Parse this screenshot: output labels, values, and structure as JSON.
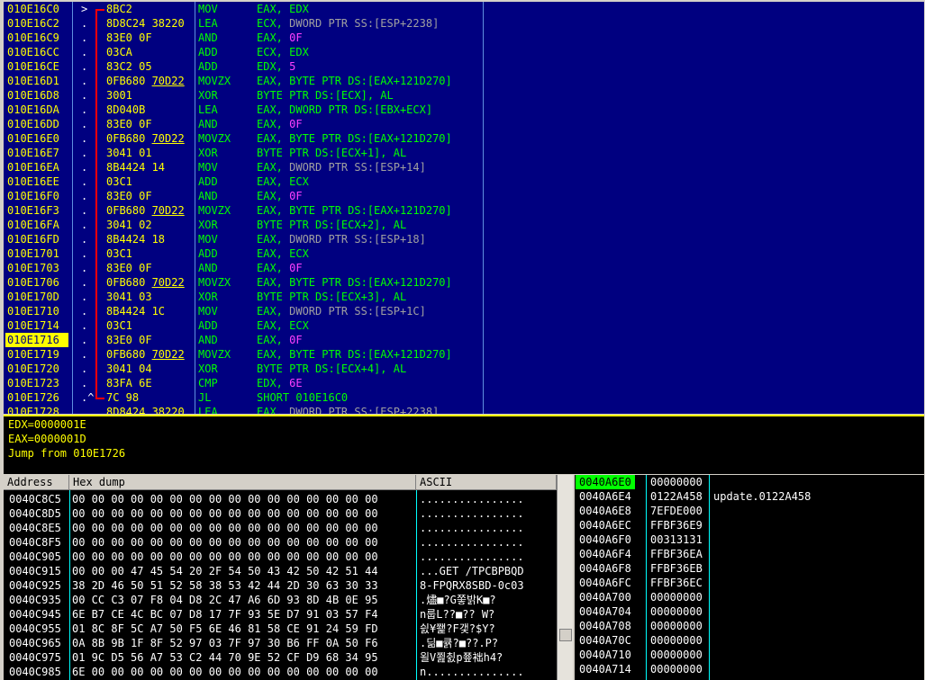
{
  "disasm": {
    "rows": [
      {
        "addr": "010E16C0",
        "mark": ">",
        "hex": "8BC2",
        "hex_ul": "",
        "mn": "MOV",
        "op": "EAX, EDX",
        "op_g": "",
        "op_m": ""
      },
      {
        "addr": "010E16C2",
        "mark": ".",
        "hex": "8D8C24 38220",
        "hex_ul": "",
        "mn": "LEA",
        "op": "ECX, ",
        "op_g": "DWORD PTR SS:[ESP+2238]",
        "op_m": ""
      },
      {
        "addr": "010E16C9",
        "mark": ".",
        "hex": "83E0 0F",
        "hex_ul": "",
        "mn": "AND",
        "op": "EAX, ",
        "op_g": "",
        "op_m": "0F"
      },
      {
        "addr": "010E16CC",
        "mark": ".",
        "hex": "03CA",
        "hex_ul": "",
        "mn": "ADD",
        "op": "ECX, EDX",
        "op_g": "",
        "op_m": ""
      },
      {
        "addr": "010E16CE",
        "mark": ".",
        "hex": "83C2 05",
        "hex_ul": "",
        "mn": "ADD",
        "op": "EDX, ",
        "op_g": "",
        "op_m": "5"
      },
      {
        "addr": "010E16D1",
        "mark": ".",
        "hex": "0FB680 ",
        "hex_ul": "70D22",
        "mn": "MOVZX",
        "op": "EAX, BYTE PTR DS:[EAX+121D270]",
        "op_g": "",
        "op_m": ""
      },
      {
        "addr": "010E16D8",
        "mark": ".",
        "hex": "3001",
        "hex_ul": "",
        "mn": "XOR",
        "op": "BYTE PTR DS:[ECX], AL",
        "op_g": "",
        "op_m": ""
      },
      {
        "addr": "010E16DA",
        "mark": ".",
        "hex": "8D040B",
        "hex_ul": "",
        "mn": "LEA",
        "op": "EAX, DWORD PTR DS:[EBX+ECX]",
        "op_g": "",
        "op_m": ""
      },
      {
        "addr": "010E16DD",
        "mark": ".",
        "hex": "83E0 0F",
        "hex_ul": "",
        "mn": "AND",
        "op": "EAX, ",
        "op_g": "",
        "op_m": "0F"
      },
      {
        "addr": "010E16E0",
        "mark": ".",
        "hex": "0FB680 ",
        "hex_ul": "70D22",
        "mn": "MOVZX",
        "op": "EAX, BYTE PTR DS:[EAX+121D270]",
        "op_g": "",
        "op_m": ""
      },
      {
        "addr": "010E16E7",
        "mark": ".",
        "hex": "3041 01",
        "hex_ul": "",
        "mn": "XOR",
        "op": "BYTE PTR DS:[ECX+1], AL",
        "op_g": "",
        "op_m": ""
      },
      {
        "addr": "010E16EA",
        "mark": ".",
        "hex": "8B4424 14",
        "hex_ul": "",
        "mn": "MOV",
        "op": "EAX, ",
        "op_g": "DWORD PTR SS:[ESP+14]",
        "op_m": ""
      },
      {
        "addr": "010E16EE",
        "mark": ".",
        "hex": "03C1",
        "hex_ul": "",
        "mn": "ADD",
        "op": "EAX, ECX",
        "op_g": "",
        "op_m": ""
      },
      {
        "addr": "010E16F0",
        "mark": ".",
        "hex": "83E0 0F",
        "hex_ul": "",
        "mn": "AND",
        "op": "EAX, ",
        "op_g": "",
        "op_m": "0F"
      },
      {
        "addr": "010E16F3",
        "mark": ".",
        "hex": "0FB680 ",
        "hex_ul": "70D22",
        "mn": "MOVZX",
        "op": "EAX, BYTE PTR DS:[EAX+121D270]",
        "op_g": "",
        "op_m": ""
      },
      {
        "addr": "010E16FA",
        "mark": ".",
        "hex": "3041 02",
        "hex_ul": "",
        "mn": "XOR",
        "op": "BYTE PTR DS:[ECX+2], AL",
        "op_g": "",
        "op_m": ""
      },
      {
        "addr": "010E16FD",
        "mark": ".",
        "hex": "8B4424 18",
        "hex_ul": "",
        "mn": "MOV",
        "op": "EAX, ",
        "op_g": "DWORD PTR SS:[ESP+18]",
        "op_m": ""
      },
      {
        "addr": "010E1701",
        "mark": ".",
        "hex": "03C1",
        "hex_ul": "",
        "mn": "ADD",
        "op": "EAX, ECX",
        "op_g": "",
        "op_m": ""
      },
      {
        "addr": "010E1703",
        "mark": ".",
        "hex": "83E0 0F",
        "hex_ul": "",
        "mn": "AND",
        "op": "EAX, ",
        "op_g": "",
        "op_m": "0F"
      },
      {
        "addr": "010E1706",
        "mark": ".",
        "hex": "0FB680 ",
        "hex_ul": "70D22",
        "mn": "MOVZX",
        "op": "EAX, BYTE PTR DS:[EAX+121D270]",
        "op_g": "",
        "op_m": ""
      },
      {
        "addr": "010E170D",
        "mark": ".",
        "hex": "3041 03",
        "hex_ul": "",
        "mn": "XOR",
        "op": "BYTE PTR DS:[ECX+3], AL",
        "op_g": "",
        "op_m": ""
      },
      {
        "addr": "010E1710",
        "mark": ".",
        "hex": "8B4424 1C",
        "hex_ul": "",
        "mn": "MOV",
        "op": "EAX, ",
        "op_g": "DWORD PTR SS:[ESP+1C]",
        "op_m": ""
      },
      {
        "addr": "010E1714",
        "mark": ".",
        "hex": "03C1",
        "hex_ul": "",
        "mn": "ADD",
        "op": "EAX, ECX",
        "op_g": "",
        "op_m": ""
      },
      {
        "addr": "010E1716",
        "mark": ".",
        "hex": "83E0 0F",
        "hex_ul": "",
        "mn": "AND",
        "op": "EAX, ",
        "op_g": "",
        "op_m": "0F",
        "selected": true
      },
      {
        "addr": "010E1719",
        "mark": ".",
        "hex": "0FB680 ",
        "hex_ul": "70D22",
        "mn": "MOVZX",
        "op": "EAX, BYTE PTR DS:[EAX+121D270]",
        "op_g": "",
        "op_m": ""
      },
      {
        "addr": "010E1720",
        "mark": ".",
        "hex": "3041 04",
        "hex_ul": "",
        "mn": "XOR",
        "op": "BYTE PTR DS:[ECX+4], AL",
        "op_g": "",
        "op_m": ""
      },
      {
        "addr": "010E1723",
        "mark": ".",
        "hex": "83FA 6E",
        "hex_ul": "",
        "mn": "CMP",
        "op": "EDX, ",
        "op_g": "",
        "op_m": "6E"
      },
      {
        "addr": "010E1726",
        "mark": ".^",
        "hex": "7C 98",
        "hex_ul": "",
        "mn": "JL",
        "op": "SHORT 010E16C0",
        "op_g": "",
        "op_m": ""
      },
      {
        "addr": "010E1728",
        "mark": "",
        "hex": "8D8424 38220",
        "hex_ul": "",
        "mn": "LEA",
        "op": "EAX, ",
        "op_g": "DWORD PTR SS:[ESP+2238]",
        "op_m": ""
      }
    ]
  },
  "info": {
    "lines": [
      "EDX=0000001E",
      "EAX=0000001D",
      "Jump from 010E1726"
    ]
  },
  "dump": {
    "headers": {
      "address": "Address",
      "hex": "Hex dump",
      "ascii": "ASCII"
    },
    "rows": [
      {
        "addr": "0040C8C5",
        "hex": "00 00 00 00 00 00 00 00 00 00 00 00 00 00 00 00",
        "ascii": "................"
      },
      {
        "addr": "0040C8D5",
        "hex": "00 00 00 00 00 00 00 00 00 00 00 00 00 00 00 00",
        "ascii": "................"
      },
      {
        "addr": "0040C8E5",
        "hex": "00 00 00 00 00 00 00 00 00 00 00 00 00 00 00 00",
        "ascii": "................"
      },
      {
        "addr": "0040C8F5",
        "hex": "00 00 00 00 00 00 00 00 00 00 00 00 00 00 00 00",
        "ascii": "................"
      },
      {
        "addr": "0040C905",
        "hex": "00 00 00 00 00 00 00 00 00 00 00 00 00 00 00 00",
        "ascii": "................"
      },
      {
        "addr": "0040C915",
        "hex": "00 00 00 47 45 54 20 2F 54 50 43 42 50 42 51 44",
        "ascii": "...GET /TPCBPBQD"
      },
      {
        "addr": "0040C925",
        "hex": "38 2D 46 50 51 52 58 38 53 42 44 2D 30 63 30 33",
        "ascii": "8-FPQRX8SBD-0c03"
      },
      {
        "addr": "0040C935",
        "hex": "00 CC C3 07 F8 04 D8 2C 47 A6 6D 93 8D 4B 0E 95",
        "ascii": ".燼■?G쫗밝K■?"
      },
      {
        "addr": "0040C945",
        "hex": "6E B7 CE 4C BC 07 D8 17 7F 93 5E D7 91 03 57 F4",
        "ascii": "n룹L??■?? W?"
      },
      {
        "addr": "0040C955",
        "hex": "01 8C 8F 5C A7 50 F5 6E 46 81 58 CE 91 24 59 FD",
        "ascii": "싌¥쬁?F갳?$Y?"
      },
      {
        "addr": "0040C965",
        "hex": "0A 8B 9B 1F 8F 52 97 03 7F 97 30 B6 FF 0A 50 F6",
        "ascii": ".딞■큙?■??.P?"
      },
      {
        "addr": "0040C975",
        "hex": "01 9C D5 56 A7 53 C2 44 70 9E 52 CF D9 68 34 95",
        "ascii": "욀V쬞췴p쭆袦h4?"
      },
      {
        "addr": "0040C985",
        "hex": "6E 00 00 00 00 00 00 00 00 00 00 00 00 00 00 00",
        "ascii": "n..............."
      }
    ]
  },
  "stack": {
    "rows": [
      {
        "addr": "0040A6E0",
        "val": "00000000",
        "cmt": "",
        "top": true
      },
      {
        "addr": "0040A6E4",
        "val": "0122A458",
        "cmt": "update.0122A458"
      },
      {
        "addr": "0040A6E8",
        "val": "7EFDE000",
        "cmt": ""
      },
      {
        "addr": "0040A6EC",
        "val": "FFBF36E9",
        "cmt": ""
      },
      {
        "addr": "0040A6F0",
        "val": "00313131",
        "cmt": ""
      },
      {
        "addr": "0040A6F4",
        "val": "FFBF36EA",
        "cmt": ""
      },
      {
        "addr": "0040A6F8",
        "val": "FFBF36EB",
        "cmt": ""
      },
      {
        "addr": "0040A6FC",
        "val": "FFBF36EC",
        "cmt": ""
      },
      {
        "addr": "0040A700",
        "val": "00000000",
        "cmt": ""
      },
      {
        "addr": "0040A704",
        "val": "00000000",
        "cmt": ""
      },
      {
        "addr": "0040A708",
        "val": "00000000",
        "cmt": ""
      },
      {
        "addr": "0040A70C",
        "val": "00000000",
        "cmt": ""
      },
      {
        "addr": "0040A710",
        "val": "00000000",
        "cmt": ""
      },
      {
        "addr": "0040A714",
        "val": "00000000",
        "cmt": ""
      }
    ]
  }
}
